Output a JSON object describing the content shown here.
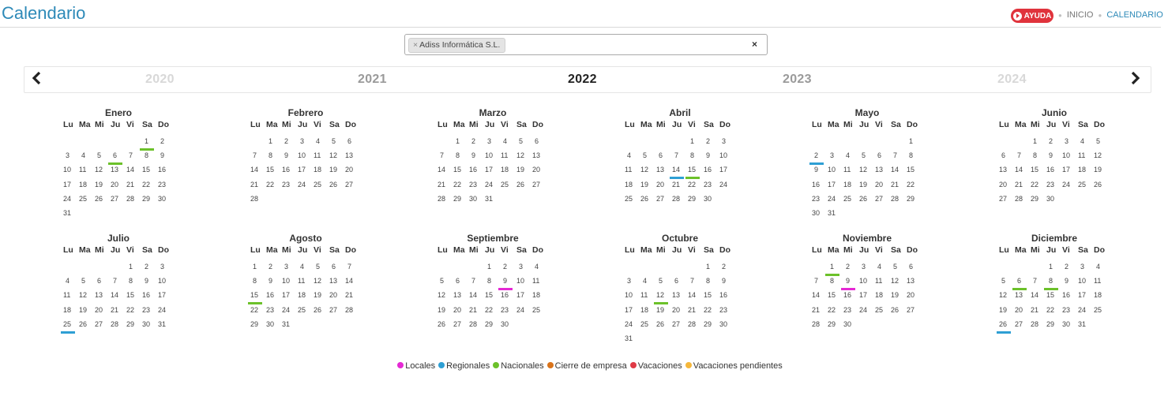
{
  "page_title": "Calendario",
  "help_label": "AYUDA",
  "breadcrumbs": [
    "INICIO",
    "CALENDARIO"
  ],
  "company_filter": {
    "chip_label": "Adiss Informática S.L.",
    "chip_remove": "×",
    "clear": "×"
  },
  "years": [
    "2020",
    "2021",
    "2022",
    "2023",
    "2024"
  ],
  "selected_year": "2022",
  "nav": {
    "prev": "‹",
    "next": "›"
  },
  "weekday_headers": [
    "Lu",
    "Ma",
    "Mi",
    "Ju",
    "Vi",
    "Sa",
    "Do"
  ],
  "colors": {
    "locales": "#e529d4",
    "regionales": "#2e9fd4",
    "nacionales": "#6cc12a",
    "cierre": "#d9731a",
    "vacaciones": "#e03a46",
    "vacaciones_pendientes": "#f5b73b",
    "accent": "#2e8ab8"
  },
  "months": [
    {
      "name": "Enero",
      "offset": 5,
      "days": 31,
      "marks": {
        "1": "nacionales",
        "6": "nacionales"
      }
    },
    {
      "name": "Febrero",
      "offset": 1,
      "days": 28,
      "marks": {}
    },
    {
      "name": "Marzo",
      "offset": 1,
      "days": 31,
      "marks": {}
    },
    {
      "name": "Abril",
      "offset": 4,
      "days": 30,
      "marks": {
        "14": "regionales",
        "15": "nacionales"
      }
    },
    {
      "name": "Mayo",
      "offset": 6,
      "days": 31,
      "marks": {
        "2": "regionales"
      }
    },
    {
      "name": "Junio",
      "offset": 2,
      "days": 30,
      "marks": {}
    },
    {
      "name": "Julio",
      "offset": 4,
      "days": 31,
      "marks": {
        "25": "regionales"
      }
    },
    {
      "name": "Agosto",
      "offset": 0,
      "days": 31,
      "marks": {
        "15": "nacionales"
      }
    },
    {
      "name": "Septiembre",
      "offset": 3,
      "days": 30,
      "marks": {
        "9": "locales"
      }
    },
    {
      "name": "Octubre",
      "offset": 5,
      "days": 31,
      "marks": {
        "12": "nacionales"
      }
    },
    {
      "name": "Noviembre",
      "offset": 1,
      "days": 30,
      "marks": {
        "1": "nacionales",
        "9": "locales"
      }
    },
    {
      "name": "Diciembre",
      "offset": 3,
      "days": 31,
      "marks": {
        "6": "nacionales",
        "8": "nacionales",
        "26": "regionales"
      }
    }
  ],
  "legend": [
    {
      "key": "locales",
      "label": "Locales"
    },
    {
      "key": "regionales",
      "label": "Regionales"
    },
    {
      "key": "nacionales",
      "label": "Nacionales"
    },
    {
      "key": "cierre",
      "label": "Cierre de empresa"
    },
    {
      "key": "vacaciones",
      "label": "Vacaciones"
    },
    {
      "key": "vacaciones_pendientes",
      "label": "Vacaciones pendientes"
    }
  ]
}
